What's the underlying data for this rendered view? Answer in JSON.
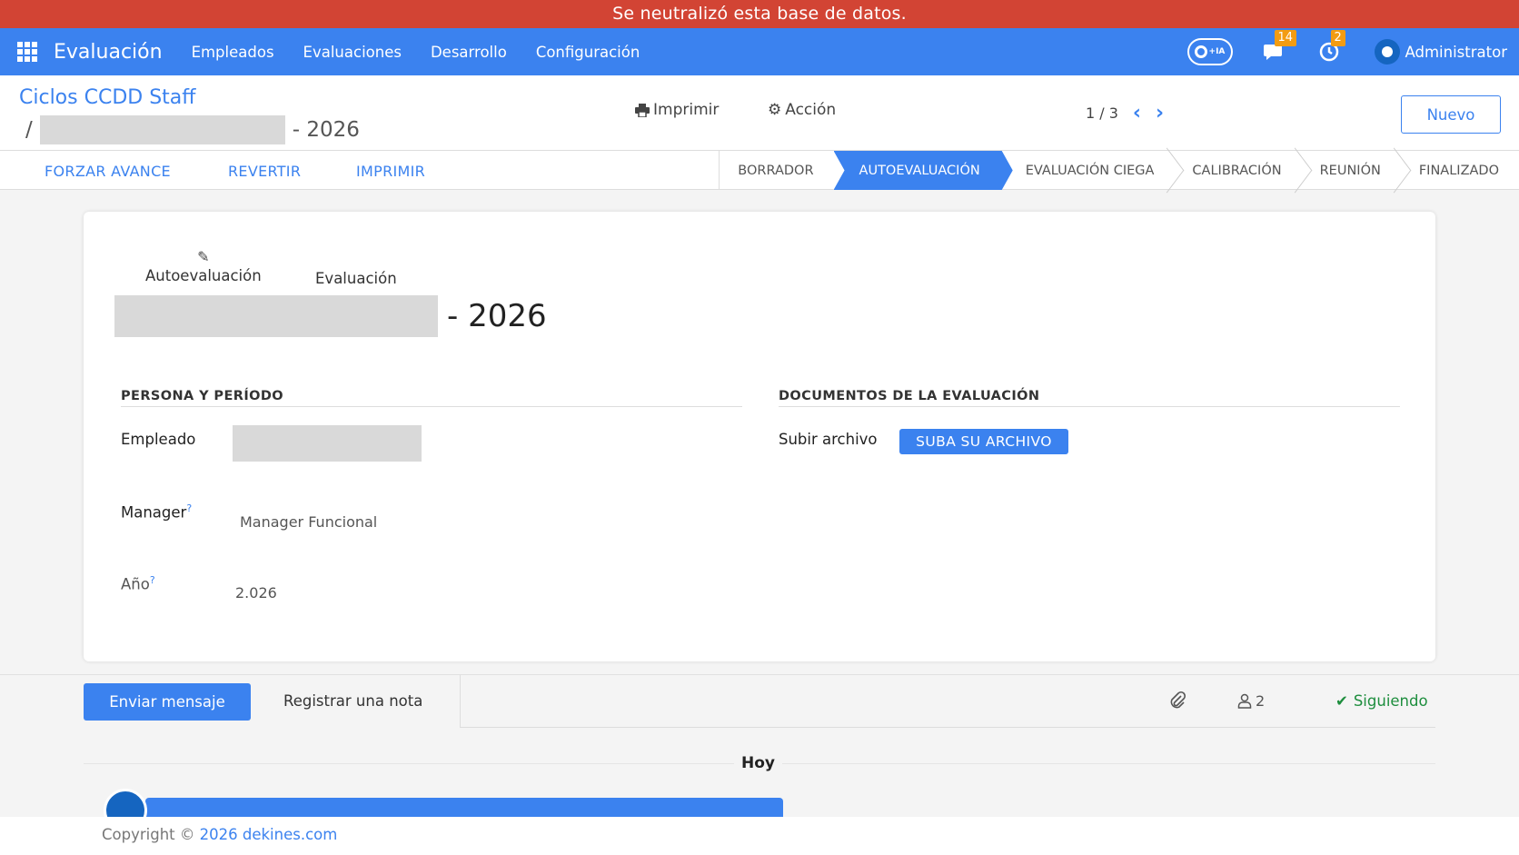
{
  "banner": {
    "text": "Se neutralizó esta base de datos."
  },
  "navbar": {
    "brand": "Evaluación",
    "menu": [
      "Empleados",
      "Evaluaciones",
      "Desarrollo",
      "Configuración"
    ],
    "ai_label": "IA",
    "messages_badge": "14",
    "activities_badge": "2",
    "user_name": "Administrator"
  },
  "control": {
    "breadcrumb": "Ciclos CCDD Staff",
    "record_prefix": "/ ",
    "record_suffix": "- 2026",
    "print_label": "Imprimir",
    "action_label": "Acción",
    "pager": "1 / 3",
    "new_label": "Nuevo"
  },
  "statusbar": {
    "buttons": [
      "FORZAR AVANCE",
      "REVERTIR",
      "IMPRIMIR"
    ],
    "stages": [
      "BORRADOR",
      "AUTOEVALUACIÓN",
      "EVALUACIÓN CIEGA",
      "CALIBRACIÓN",
      "REUNIÓN",
      "FINALIZADO"
    ],
    "active_stage": "AUTOEVALUACIÓN"
  },
  "sheet": {
    "smart_buttons": [
      "Autoevaluación",
      "Evaluación"
    ],
    "title_year": "- 2026",
    "group_left": "PERSONA Y PERÍODO",
    "group_right": "DOCUMENTOS DE LA EVALUACIÓN",
    "employee_label": "Empleado",
    "manager_label": "Manager",
    "manager_value": "Manager Funcional",
    "year_label": "Año",
    "year_value": "2.026",
    "tooltip_mark": "?",
    "upload_label": "Subir archivo",
    "upload_button": "SUBA SU ARCHIVO"
  },
  "chatter": {
    "send_label": "Enviar mensaje",
    "note_label": "Registrar una nota",
    "followers_count": "2",
    "following_label": "Siguiendo",
    "today_label": "Hoy"
  },
  "footer": {
    "copyright_prefix": "Copyright © ",
    "copyright_link": "2026 dekines.com"
  },
  "colors": {
    "primary": "#3b82ef",
    "banner": "#d24434",
    "badge": "#f39c12",
    "following": "#1e8e3e"
  }
}
